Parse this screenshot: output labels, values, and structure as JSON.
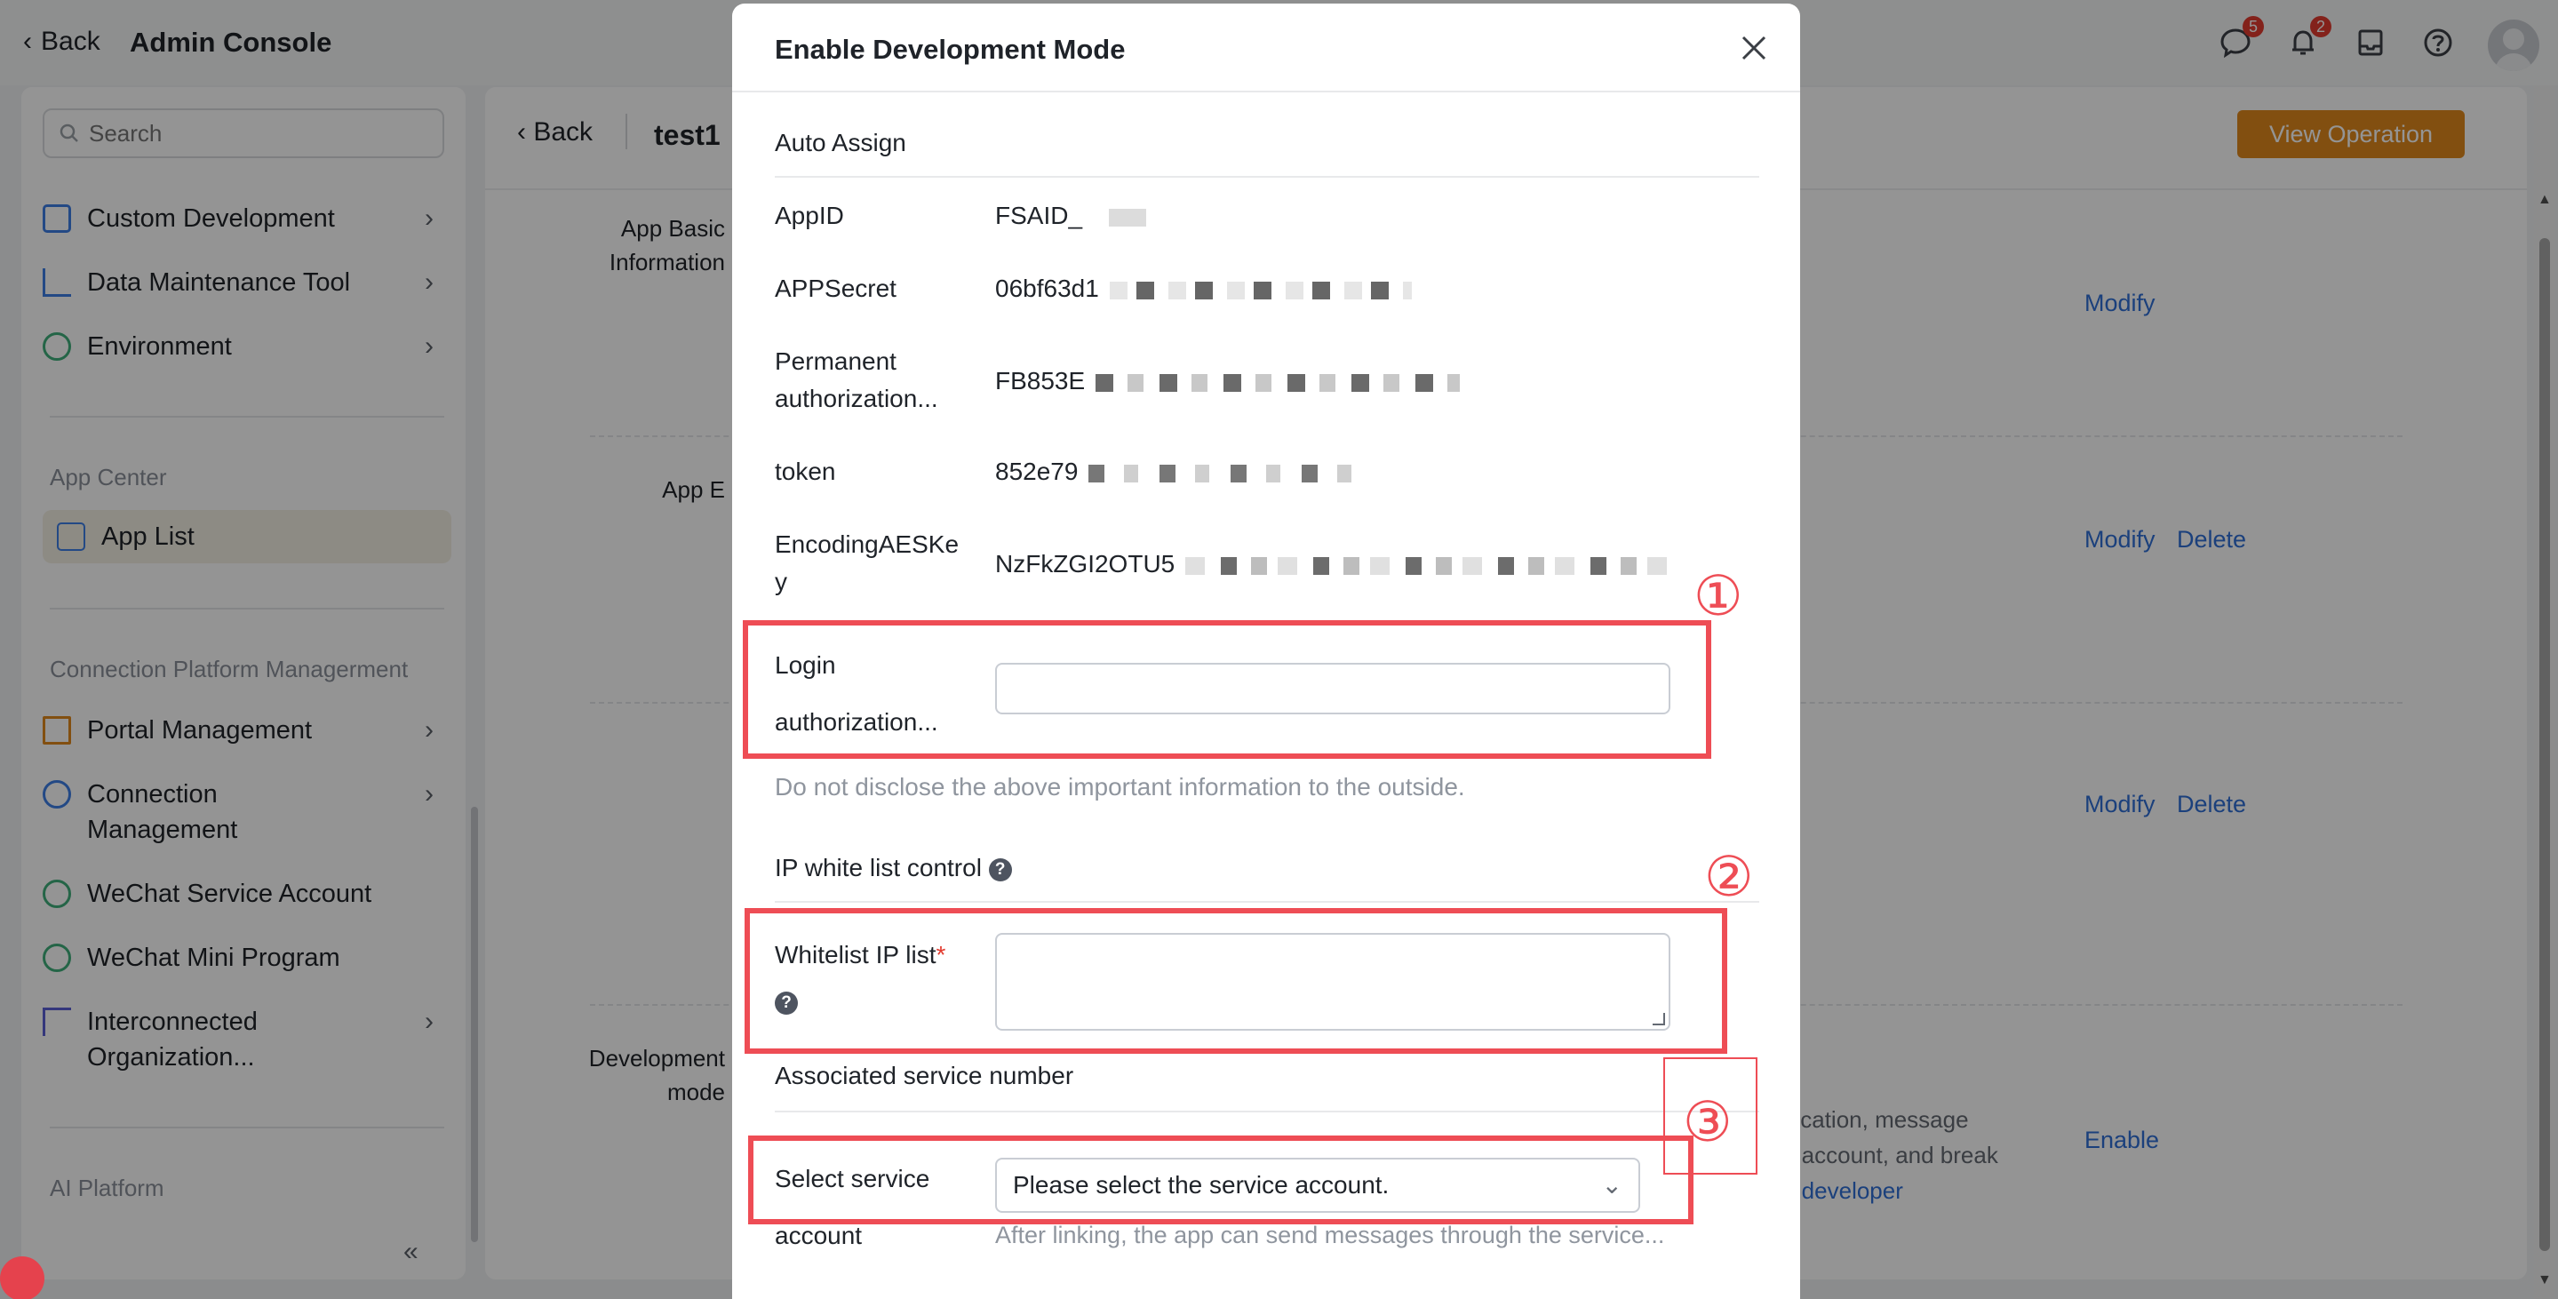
{
  "topbar": {
    "back_label": "Back",
    "title": "Admin Console",
    "icons": [
      {
        "name": "message-icon",
        "badge": "5"
      },
      {
        "name": "bell-icon",
        "badge": "2"
      },
      {
        "name": "inbox-icon",
        "badge": ""
      },
      {
        "name": "help-icon",
        "badge": ""
      }
    ]
  },
  "sidebar": {
    "search_placeholder": "Search",
    "items_top": [
      {
        "label": "Custom Development",
        "icon": "code-icon"
      },
      {
        "label": "Data Maintenance Tool",
        "icon": "bar-chart-icon"
      },
      {
        "label": "Environment",
        "icon": "environment-icon"
      }
    ],
    "section_app_center": "App Center",
    "app_list": "App List",
    "section_connection": "Connection Platform Managerment",
    "items_connection": [
      {
        "label": "Portal Management",
        "icon": "portal-icon"
      },
      {
        "label": "Connection Management",
        "icon": "link-icon"
      },
      {
        "label": "WeChat Service Account",
        "icon": "wechat-icon"
      },
      {
        "label": "WeChat Mini Program",
        "icon": "mini-program-icon"
      },
      {
        "label": "Interconnected Organization...",
        "icon": "flag-icon"
      }
    ],
    "section_ai": "AI Platform"
  },
  "main": {
    "back_label": "Back",
    "title": "test1",
    "history_button": "View Operation History",
    "section_app_basic": "App Basic Information",
    "section_app_e": "App E",
    "section_develop": "Development mode",
    "modify": "Modify",
    "delete": "Delete",
    "enable": "Enable",
    "dev_text_1": "nication, message",
    "dev_text_2": "d account, and break",
    "dev_link": "n developer"
  },
  "modal": {
    "title": "Enable Development Mode",
    "auto_assign": "Auto Assign",
    "app_id_label": "AppID",
    "app_id_value": "FSAID_",
    "app_secret_label": "APPSecret",
    "app_secret_value": "06bf63d1",
    "perm_auth_label_1": "Permanent",
    "perm_auth_label_2": "authorization...",
    "perm_auth_value": "FB853E",
    "token_label": "token",
    "token_value": "852e79",
    "aes_label_1": "EncodingAESKe",
    "aes_label_2": "y",
    "aes_value": "NzFkZGI2OTU5",
    "login_auth_label_1": "Login",
    "login_auth_label_2": "authorization...",
    "login_auth_value": "",
    "disclose_hint": "Do not disclose the above important information to the outside.",
    "ip_control_label": "IP white list control",
    "whitelist_label": "Whitelist IP list",
    "whitelist_required": "*",
    "whitelist_value": "",
    "assoc_service_label": "Associated service number",
    "select_service_label_1": "Select service",
    "select_service_label_2": "account",
    "select_placeholder": "Please select the service account.",
    "select_hint": "After linking, the app can send messages through the service..."
  },
  "annotations": [
    "①",
    "②",
    "③"
  ],
  "colors": {
    "accent": "#2f6fd6",
    "history_button": "#e0891c",
    "annotation": "#ee4d55",
    "badge": "#e23b2f"
  }
}
